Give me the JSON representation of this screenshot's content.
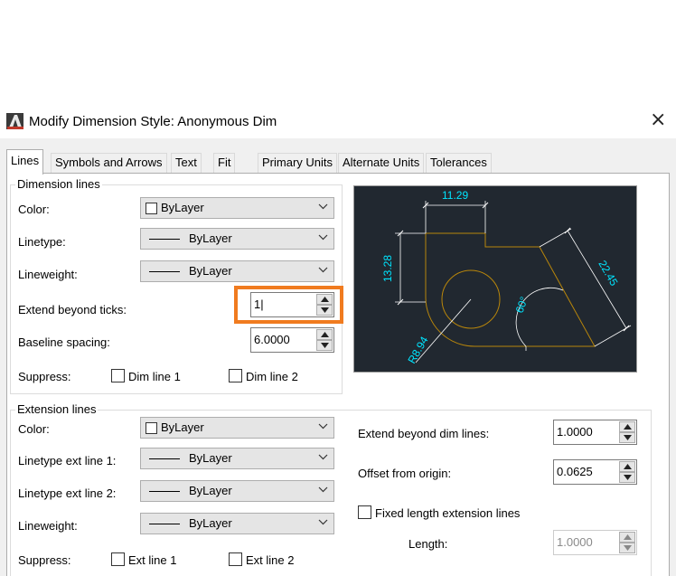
{
  "window": {
    "title": "Modify Dimension Style: Anonymous Dim",
    "app_icon": "autocad-icon",
    "close_symbol": "×"
  },
  "tabs": [
    {
      "label": "Lines",
      "active": true
    },
    {
      "label": "Symbols and Arrows",
      "active": false
    },
    {
      "label": "Text",
      "active": false
    },
    {
      "label": "Fit",
      "active": false
    },
    {
      "label": "Primary Units",
      "active": false
    },
    {
      "label": "Alternate Units",
      "active": false
    },
    {
      "label": "Tolerances",
      "active": false
    }
  ],
  "dimension_lines": {
    "title": "Dimension lines",
    "color_label": "Color:",
    "color_value": "ByLayer",
    "linetype_label": "Linetype:",
    "linetype_value": "ByLayer",
    "lineweight_label": "Lineweight:",
    "lineweight_value": "ByLayer",
    "extend_label": "Extend beyond ticks:",
    "extend_value": "1|",
    "baseline_label": "Baseline spacing:",
    "baseline_value": "6.0000",
    "suppress_label": "Suppress:",
    "dim_line_1": "Dim line 1",
    "dim_line_2": "Dim line 2"
  },
  "extension_lines": {
    "title": "Extension lines",
    "color_label": "Color:",
    "color_value": "ByLayer",
    "linetype1_label": "Linetype ext line 1:",
    "linetype1_value": "ByLayer",
    "linetype2_label": "Linetype ext line 2:",
    "linetype2_value": "ByLayer",
    "lineweight_label": "Lineweight:",
    "lineweight_value": "ByLayer",
    "suppress_label": "Suppress:",
    "ext_line_1": "Ext line 1",
    "ext_line_2": "Ext line 2",
    "extend_beyond_label": "Extend beyond dim lines:",
    "extend_beyond_value": "1.0000",
    "offset_label": "Offset from origin:",
    "offset_value": "0.0625",
    "fixed_length_label": "Fixed length extension lines",
    "length_label": "Length:",
    "length_value": "1.0000"
  },
  "preview": {
    "dim_top": "11.29",
    "dim_left": "13.28",
    "dim_right": "22.45",
    "dim_angle": "60°",
    "dim_radius": "R8.94"
  },
  "colors": {
    "highlight": "#f07b1f",
    "preview_bg": "#212830",
    "preview_dim": "#00e5ff",
    "preview_geom": "#b8860b"
  }
}
